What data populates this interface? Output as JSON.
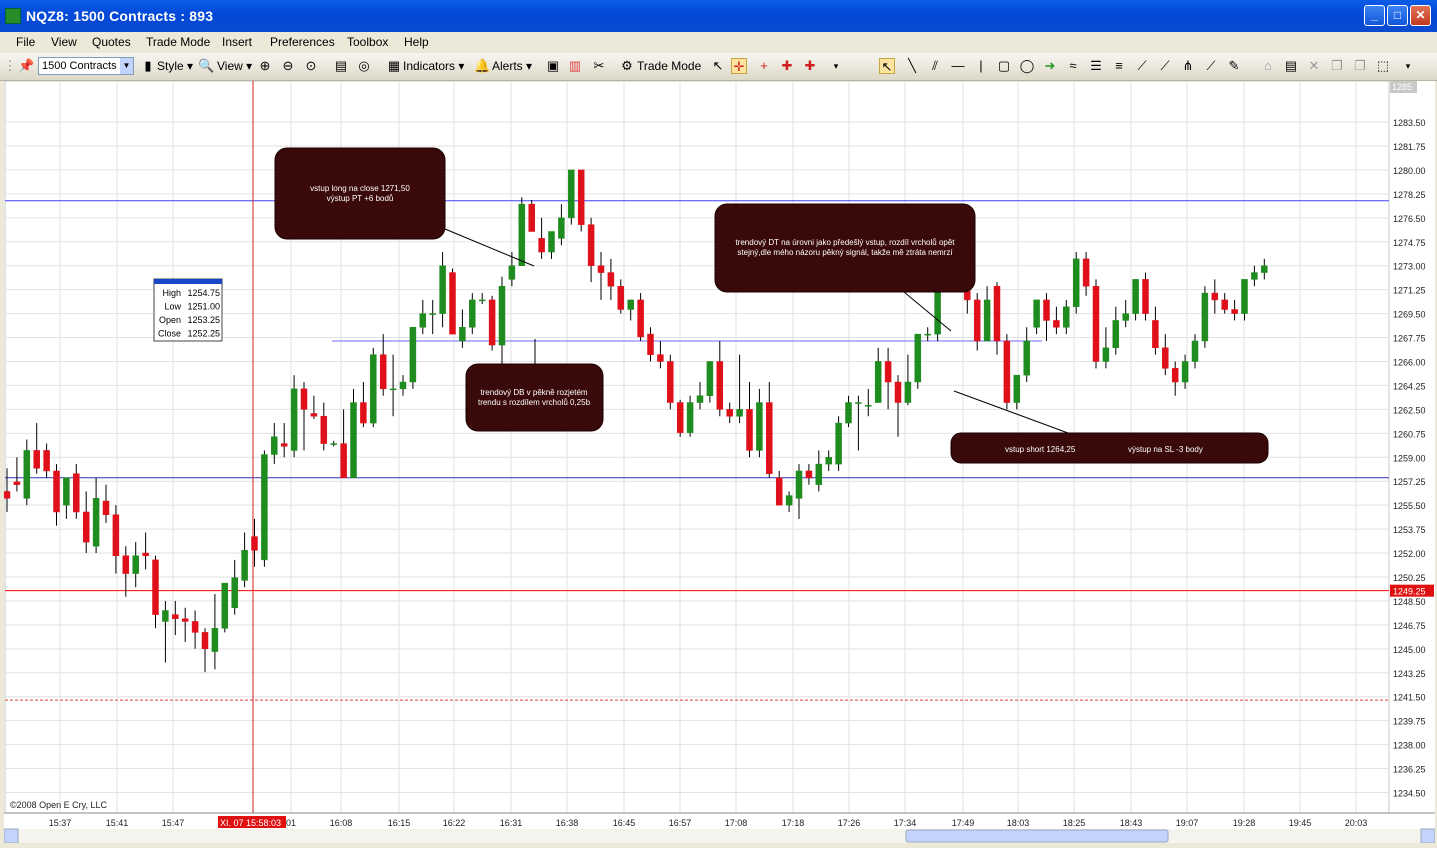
{
  "window": {
    "title": "NQZ8: 1500 Contracts : 893"
  },
  "menu": [
    "File",
    "View",
    "Quotes",
    "Trade Mode",
    "Insert",
    "Preferences",
    "Toolbox",
    "Help"
  ],
  "toolbar": {
    "contracts": "1500 Contracts",
    "style_label": "Style",
    "view_label": "View",
    "indicators_label": "Indicators",
    "alerts_label": "Alerts",
    "trade_mode_label": "Trade Mode"
  },
  "chart_data": {
    "type": "candlestick",
    "title": "",
    "ylim": [
      1233,
      1286.5
    ],
    "y_ticks": [
      "1283.50",
      "1281.75",
      "1280.00",
      "1278.25",
      "1276.50",
      "1274.75",
      "1273.00",
      "1271.25",
      "1269.50",
      "1267.75",
      "1266.00",
      "1264.25",
      "1262.50",
      "1260.75",
      "1259.00",
      "1257.25",
      "1255.50",
      "1253.75",
      "1252.00",
      "1250.25",
      "1248.50",
      "1246.75",
      "1245.00",
      "1243.25",
      "1241.50",
      "1239.75",
      "1238.00",
      "1236.25",
      "1234.50"
    ],
    "x_ticks": [
      "15:37",
      "15:41",
      "15:47",
      "16:01",
      "16:08",
      "16:15",
      "16:22",
      "16:31",
      "16:38",
      "16:45",
      "16:57",
      "17:08",
      "17:18",
      "17:26",
      "17:34",
      "17:49",
      "18:03",
      "18:25",
      "18:43",
      "19:07",
      "19:28",
      "19:45",
      "20:03"
    ],
    "crosshair_time_label": "XI. 07 15:58:03",
    "top_price_label": "1285",
    "last_price": 1249.25,
    "horizontal_lines": [
      {
        "price": 1277.75,
        "color": "#4040ff",
        "style": "solid"
      },
      {
        "price": 1267.5,
        "color": "#6a6aff",
        "style": "solid",
        "partial": true
      },
      {
        "price": 1257.5,
        "color": "#3030c0",
        "style": "solid"
      },
      {
        "price": 1249.25,
        "color": "#ff0000",
        "style": "solid"
      },
      {
        "price": 1241.25,
        "color": "#e04040",
        "style": "dashed"
      }
    ],
    "data_window": {
      "High": "1254.75",
      "Low": "1251.00",
      "Open": "1253.25",
      "Close": "1252.25"
    },
    "annotations": [
      {
        "text": [
          "vstup long na close 1271,50",
          "výstup PT +6 bodů"
        ]
      },
      {
        "text": [
          "trendový DB v pěkně rozjetém",
          "trendu s rozdílem vrcholů 0,25b"
        ]
      },
      {
        "text": [
          "trendový DT na úrovni jako předešlý vstup, rozdíl vrcholů opět",
          "stejný,dle mého názoru pěkný signál, takže mě ztráta nemrzí"
        ]
      },
      {
        "text": [
          "vstup short 1264,25",
          "výstup na SL -3 body"
        ]
      }
    ],
    "copyright": "©2008 Open E Cry, LLC",
    "candles": [
      {
        "o": 1256.5,
        "h": 1258.2,
        "l": 1255.0,
        "c": 1256.0
      },
      {
        "o": 1257.2,
        "h": 1259.0,
        "l": 1256.5,
        "c": 1257.0
      },
      {
        "o": 1256.0,
        "h": 1260.3,
        "l": 1255.5,
        "c": 1259.5
      },
      {
        "o": 1259.5,
        "h": 1261.5,
        "l": 1257.8,
        "c": 1258.2
      },
      {
        "o": 1259.5,
        "h": 1260.0,
        "l": 1257.5,
        "c": 1258.0
      },
      {
        "o": 1258.0,
        "h": 1258.5,
        "l": 1254.0,
        "c": 1255.0
      },
      {
        "o": 1255.5,
        "h": 1257.5,
        "l": 1254.5,
        "c": 1257.5
      },
      {
        "o": 1257.8,
        "h": 1258.5,
        "l": 1254.5,
        "c": 1255.0
      },
      {
        "o": 1255.0,
        "h": 1256.5,
        "l": 1252.0,
        "c": 1252.8
      },
      {
        "o": 1252.5,
        "h": 1257.5,
        "l": 1252.0,
        "c": 1256.0
      },
      {
        "o": 1255.8,
        "h": 1257.0,
        "l": 1254.2,
        "c": 1254.8
      },
      {
        "o": 1254.8,
        "h": 1255.5,
        "l": 1250.5,
        "c": 1251.8
      },
      {
        "o": 1251.8,
        "h": 1252.5,
        "l": 1248.8,
        "c": 1250.5
      },
      {
        "o": 1250.5,
        "h": 1252.8,
        "l": 1249.5,
        "c": 1251.8
      },
      {
        "o": 1252.0,
        "h": 1253.5,
        "l": 1250.8,
        "c": 1251.8
      },
      {
        "o": 1251.5,
        "h": 1251.8,
        "l": 1246.5,
        "c": 1247.5
      },
      {
        "o": 1247.0,
        "h": 1248.5,
        "l": 1244.0,
        "c": 1247.8
      },
      {
        "o": 1247.5,
        "h": 1248.5,
        "l": 1246.0,
        "c": 1247.2
      },
      {
        "o": 1247.2,
        "h": 1248.0,
        "l": 1245.5,
        "c": 1247.0
      },
      {
        "o": 1247.0,
        "h": 1247.8,
        "l": 1245.0,
        "c": 1246.2
      },
      {
        "o": 1246.2,
        "h": 1246.5,
        "l": 1243.3,
        "c": 1245.0
      },
      {
        "o": 1244.8,
        "h": 1249.0,
        "l": 1243.5,
        "c": 1246.5
      },
      {
        "o": 1246.5,
        "h": 1249.8,
        "l": 1246.2,
        "c": 1249.8
      },
      {
        "o": 1248.0,
        "h": 1251.5,
        "l": 1247.5,
        "c": 1250.2
      },
      {
        "o": 1250.0,
        "h": 1253.5,
        "l": 1249.5,
        "c": 1252.2
      },
      {
        "o": 1253.2,
        "h": 1254.5,
        "l": 1251.0,
        "c": 1252.2
      },
      {
        "o": 1251.5,
        "h": 1259.5,
        "l": 1251.0,
        "c": 1259.2
      },
      {
        "o": 1259.2,
        "h": 1261.5,
        "l": 1258.5,
        "c": 1260.5
      },
      {
        "o": 1260.0,
        "h": 1261.5,
        "l": 1259.0,
        "c": 1259.8
      },
      {
        "o": 1259.5,
        "h": 1265.0,
        "l": 1259.0,
        "c": 1264.0
      },
      {
        "o": 1264.0,
        "h": 1264.5,
        "l": 1259.5,
        "c": 1262.5
      },
      {
        "o": 1262.2,
        "h": 1263.5,
        "l": 1261.8,
        "c": 1262.0
      },
      {
        "o": 1262.0,
        "h": 1263.0,
        "l": 1259.5,
        "c": 1260.0
      },
      {
        "o": 1260.0,
        "h": 1260.2,
        "l": 1259.8,
        "c": 1260.0
      },
      {
        "o": 1260.0,
        "h": 1262.5,
        "l": 1257.5,
        "c": 1257.5
      },
      {
        "o": 1257.5,
        "h": 1264.0,
        "l": 1257.5,
        "c": 1263.0
      },
      {
        "o": 1263.0,
        "h": 1264.5,
        "l": 1261.2,
        "c": 1261.5
      },
      {
        "o": 1261.5,
        "h": 1267.0,
        "l": 1261.2,
        "c": 1266.5
      },
      {
        "o": 1266.5,
        "h": 1268.0,
        "l": 1263.5,
        "c": 1264.0
      },
      {
        "o": 1264.0,
        "h": 1266.5,
        "l": 1262.0,
        "c": 1264.0
      },
      {
        "o": 1264.0,
        "h": 1265.0,
        "l": 1263.5,
        "c": 1264.5
      },
      {
        "o": 1264.5,
        "h": 1268.5,
        "l": 1264.0,
        "c": 1268.5
      },
      {
        "o": 1268.5,
        "h": 1270.5,
        "l": 1268.0,
        "c": 1269.5
      },
      {
        "o": 1269.5,
        "h": 1270.5,
        "l": 1268.0,
        "c": 1269.5
      },
      {
        "o": 1269.5,
        "h": 1274.0,
        "l": 1268.5,
        "c": 1273.0
      },
      {
        "o": 1272.5,
        "h": 1272.8,
        "l": 1268.0,
        "c": 1268.0
      },
      {
        "o": 1267.5,
        "h": 1269.8,
        "l": 1267.0,
        "c": 1268.5
      },
      {
        "o": 1268.5,
        "h": 1271.0,
        "l": 1268.0,
        "c": 1270.5
      },
      {
        "o": 1270.5,
        "h": 1271.0,
        "l": 1270.2,
        "c": 1270.5
      },
      {
        "o": 1270.5,
        "h": 1270.8,
        "l": 1266.8,
        "c": 1267.2
      },
      {
        "o": 1267.2,
        "h": 1272.2,
        "l": 1265.8,
        "c": 1271.5
      },
      {
        "o": 1272.0,
        "h": 1274.0,
        "l": 1271.5,
        "c": 1273.0
      },
      {
        "o": 1273.0,
        "h": 1278.0,
        "l": 1273.0,
        "c": 1277.5
      },
      {
        "o": 1277.5,
        "h": 1277.8,
        "l": 1275.5,
        "c": 1275.5
      },
      {
        "o": 1275.0,
        "h": 1276.5,
        "l": 1273.5,
        "c": 1274.0
      },
      {
        "o": 1274.0,
        "h": 1275.0,
        "l": 1273.5,
        "c": 1275.5
      },
      {
        "o": 1275.0,
        "h": 1277.5,
        "l": 1274.5,
        "c": 1276.5
      },
      {
        "o": 1276.5,
        "h": 1280.0,
        "l": 1276.0,
        "c": 1280.0
      },
      {
        "o": 1280.0,
        "h": 1280.0,
        "l": 1275.5,
        "c": 1276.0
      },
      {
        "o": 1276.0,
        "h": 1276.5,
        "l": 1271.8,
        "c": 1273.0
      },
      {
        "o": 1273.0,
        "h": 1274.0,
        "l": 1270.5,
        "c": 1272.5
      },
      {
        "o": 1272.5,
        "h": 1273.5,
        "l": 1270.5,
        "c": 1271.5
      },
      {
        "o": 1271.5,
        "h": 1272.0,
        "l": 1269.5,
        "c": 1269.8
      },
      {
        "o": 1269.8,
        "h": 1270.5,
        "l": 1269.0,
        "c": 1270.5
      },
      {
        "o": 1270.5,
        "h": 1271.0,
        "l": 1267.5,
        "c": 1267.8
      },
      {
        "o": 1268.0,
        "h": 1268.5,
        "l": 1266.0,
        "c": 1266.5
      },
      {
        "o": 1266.5,
        "h": 1267.5,
        "l": 1265.5,
        "c": 1266.0
      },
      {
        "o": 1266.0,
        "h": 1266.5,
        "l": 1262.5,
        "c": 1263.0
      },
      {
        "o": 1263.0,
        "h": 1263.2,
        "l": 1260.5,
        "c": 1260.8
      },
      {
        "o": 1260.8,
        "h": 1263.5,
        "l": 1260.5,
        "c": 1263.0
      },
      {
        "o": 1263.0,
        "h": 1264.5,
        "l": 1262.5,
        "c": 1263.5
      },
      {
        "o": 1263.5,
        "h": 1266.0,
        "l": 1263.0,
        "c": 1266.0
      },
      {
        "o": 1266.0,
        "h": 1267.5,
        "l": 1262.0,
        "c": 1262.5
      },
      {
        "o": 1262.5,
        "h": 1263.0,
        "l": 1261.5,
        "c": 1262.0
      },
      {
        "o": 1262.0,
        "h": 1266.5,
        "l": 1261.5,
        "c": 1262.5
      },
      {
        "o": 1262.5,
        "h": 1264.5,
        "l": 1259.0,
        "c": 1259.5
      },
      {
        "o": 1259.5,
        "h": 1264.0,
        "l": 1259.0,
        "c": 1263.0
      },
      {
        "o": 1263.0,
        "h": 1264.5,
        "l": 1257.5,
        "c": 1257.8
      },
      {
        "o": 1257.5,
        "h": 1258.0,
        "l": 1255.5,
        "c": 1255.5
      },
      {
        "o": 1255.5,
        "h": 1256.5,
        "l": 1255.0,
        "c": 1256.2
      },
      {
        "o": 1256.0,
        "h": 1258.5,
        "l": 1254.5,
        "c": 1258.0
      },
      {
        "o": 1258.0,
        "h": 1258.5,
        "l": 1257.0,
        "c": 1257.5
      },
      {
        "o": 1257.0,
        "h": 1259.5,
        "l": 1256.5,
        "c": 1258.5
      },
      {
        "o": 1258.5,
        "h": 1259.5,
        "l": 1258.0,
        "c": 1259.0
      },
      {
        "o": 1258.5,
        "h": 1262.0,
        "l": 1258.0,
        "c": 1261.5
      },
      {
        "o": 1261.5,
        "h": 1263.5,
        "l": 1261.2,
        "c": 1263.0
      },
      {
        "o": 1263.0,
        "h": 1263.5,
        "l": 1259.5,
        "c": 1263.0
      },
      {
        "o": 1262.8,
        "h": 1264.0,
        "l": 1262.0,
        "c": 1262.8
      },
      {
        "o": 1263.0,
        "h": 1267.0,
        "l": 1263.0,
        "c": 1266.0
      },
      {
        "o": 1266.0,
        "h": 1267.0,
        "l": 1262.5,
        "c": 1264.5
      },
      {
        "o": 1264.5,
        "h": 1265.0,
        "l": 1260.5,
        "c": 1263.0
      },
      {
        "o": 1263.0,
        "h": 1266.5,
        "l": 1262.8,
        "c": 1264.5
      },
      {
        "o": 1264.5,
        "h": 1268.0,
        "l": 1264.0,
        "c": 1268.0
      },
      {
        "o": 1268.0,
        "h": 1268.5,
        "l": 1267.5,
        "c": 1268.0
      },
      {
        "o": 1268.0,
        "h": 1272.5,
        "l": 1267.5,
        "c": 1272.5
      },
      {
        "o": 1272.5,
        "h": 1274.0,
        "l": 1271.5,
        "c": 1273.0
      },
      {
        "o": 1273.0,
        "h": 1274.5,
        "l": 1272.5,
        "c": 1273.5
      },
      {
        "o": 1273.5,
        "h": 1274.0,
        "l": 1269.5,
        "c": 1270.5
      },
      {
        "o": 1270.5,
        "h": 1271.0,
        "l": 1266.8,
        "c": 1267.5
      },
      {
        "o": 1267.5,
        "h": 1271.5,
        "l": 1267.5,
        "c": 1270.5
      },
      {
        "o": 1271.5,
        "h": 1271.8,
        "l": 1266.5,
        "c": 1267.5
      },
      {
        "o": 1267.5,
        "h": 1268.0,
        "l": 1262.5,
        "c": 1263.0
      },
      {
        "o": 1263.0,
        "h": 1265.0,
        "l": 1262.5,
        "c": 1265.0
      },
      {
        "o": 1265.0,
        "h": 1268.5,
        "l": 1264.5,
        "c": 1267.5
      },
      {
        "o": 1268.5,
        "h": 1270.5,
        "l": 1268.0,
        "c": 1270.5
      },
      {
        "o": 1270.5,
        "h": 1271.0,
        "l": 1267.5,
        "c": 1269.0
      },
      {
        "o": 1269.0,
        "h": 1270.0,
        "l": 1268.0,
        "c": 1268.5
      },
      {
        "o": 1268.5,
        "h": 1270.5,
        "l": 1268.0,
        "c": 1270.0
      },
      {
        "o": 1270.0,
        "h": 1274.0,
        "l": 1269.5,
        "c": 1273.5
      },
      {
        "o": 1273.5,
        "h": 1274.0,
        "l": 1270.8,
        "c": 1271.5
      },
      {
        "o": 1271.5,
        "h": 1272.0,
        "l": 1265.5,
        "c": 1266.0
      },
      {
        "o": 1266.0,
        "h": 1268.5,
        "l": 1265.5,
        "c": 1267.0
      },
      {
        "o": 1267.0,
        "h": 1270.0,
        "l": 1266.5,
        "c": 1269.0
      },
      {
        "o": 1269.0,
        "h": 1270.5,
        "l": 1268.5,
        "c": 1269.5
      },
      {
        "o": 1269.5,
        "h": 1272.0,
        "l": 1269.0,
        "c": 1272.0
      },
      {
        "o": 1272.0,
        "h": 1272.5,
        "l": 1269.0,
        "c": 1269.5
      },
      {
        "o": 1269.0,
        "h": 1270.0,
        "l": 1266.5,
        "c": 1267.0
      },
      {
        "o": 1267.0,
        "h": 1268.0,
        "l": 1265.0,
        "c": 1265.5
      },
      {
        "o": 1265.5,
        "h": 1266.0,
        "l": 1263.5,
        "c": 1264.5
      },
      {
        "o": 1264.5,
        "h": 1266.5,
        "l": 1264.0,
        "c": 1266.0
      },
      {
        "o": 1266.0,
        "h": 1268.0,
        "l": 1265.5,
        "c": 1267.5
      },
      {
        "o": 1267.5,
        "h": 1271.5,
        "l": 1267.0,
        "c": 1271.0
      },
      {
        "o": 1271.0,
        "h": 1272.0,
        "l": 1269.5,
        "c": 1270.5
      },
      {
        "o": 1270.5,
        "h": 1271.0,
        "l": 1269.5,
        "c": 1269.8
      },
      {
        "o": 1269.8,
        "h": 1270.5,
        "l": 1269.0,
        "c": 1269.5
      },
      {
        "o": 1269.5,
        "h": 1272.0,
        "l": 1269.0,
        "c": 1272.0
      },
      {
        "o": 1272.0,
        "h": 1273.0,
        "l": 1271.5,
        "c": 1272.5
      },
      {
        "o": 1272.5,
        "h": 1273.5,
        "l": 1272.0,
        "c": 1273.0
      }
    ]
  }
}
